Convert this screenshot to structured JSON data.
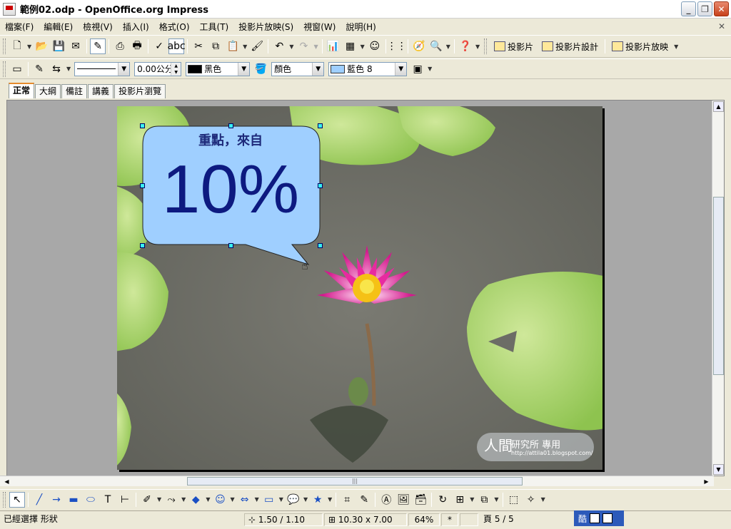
{
  "window": {
    "title": "範例02.odp - OpenOffice.org Impress"
  },
  "menu": {
    "items": [
      "檔案(F)",
      "編輯(E)",
      "檢視(V)",
      "插入(I)",
      "格式(O)",
      "工具(T)",
      "投影片放映(S)",
      "視窗(W)",
      "說明(H)"
    ]
  },
  "toolbar": {
    "slide_label": "投影片",
    "slide_design_label": "投影片設計",
    "slideshow_label": "投影片放映"
  },
  "format_toolbar": {
    "line_width": "0.00公分",
    "line_color": "黑色",
    "line_color_hex": "#000000",
    "area_style": "顏色",
    "fill_color": "藍色 8",
    "fill_color_hex": "#9fcfff"
  },
  "tabs": [
    "正常",
    "大綱",
    "備註",
    "講義",
    "投影片瀏覽"
  ],
  "slide": {
    "callout_caption": "重點，來自",
    "callout_value": "10%",
    "watermark_main": "人間",
    "watermark_sub": "研究所 專用",
    "watermark_url": "http://attila01.blogspot.com/"
  },
  "status": {
    "message": "已經選擇 形狀",
    "position": "1.50 / 1.10",
    "size": "10.30 x 7.00",
    "zoom": "64%",
    "modified": "*",
    "page": "頁 5 / 5",
    "ime_text": "酷"
  },
  "colors": {
    "accent_tab": "#e68b2c",
    "callout_fill": "#9fcfff",
    "callout_text": "#0d1a80"
  }
}
